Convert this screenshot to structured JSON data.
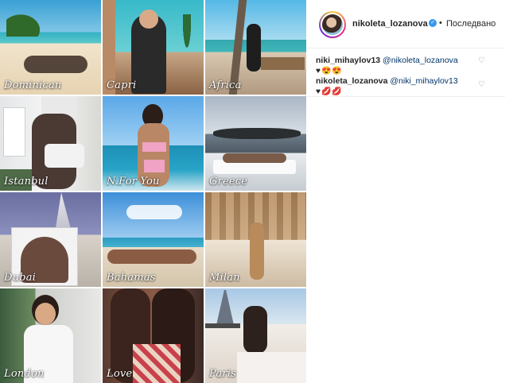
{
  "grid": {
    "tiles": [
      {
        "caption": "Dominican"
      },
      {
        "caption": "Capri"
      },
      {
        "caption": "Africa"
      },
      {
        "caption": "Istanbul"
      },
      {
        "caption": "N.For You"
      },
      {
        "caption": "Greece"
      },
      {
        "caption": "Dubai"
      },
      {
        "caption": "Bahamas"
      },
      {
        "caption": "Milan"
      },
      {
        "caption": "London"
      },
      {
        "caption": "Love"
      },
      {
        "caption": "Paris"
      }
    ]
  },
  "header": {
    "username": "nikoleta_lozanova",
    "verified_symbol": "✓",
    "separator": "•",
    "follow_status": "Последвано"
  },
  "comments": [
    {
      "user": "niki_mihaylov13",
      "mention": "@nikoleta_lozanova",
      "emoji": "♥😍😍"
    },
    {
      "user": "nikoleta_lozanova",
      "mention": "@niki_mihaylov13",
      "emoji": "♥💋💋"
    }
  ],
  "colors": {
    "accent_verified": "#3897f0",
    "mention": "#003569",
    "text": "#262626"
  }
}
